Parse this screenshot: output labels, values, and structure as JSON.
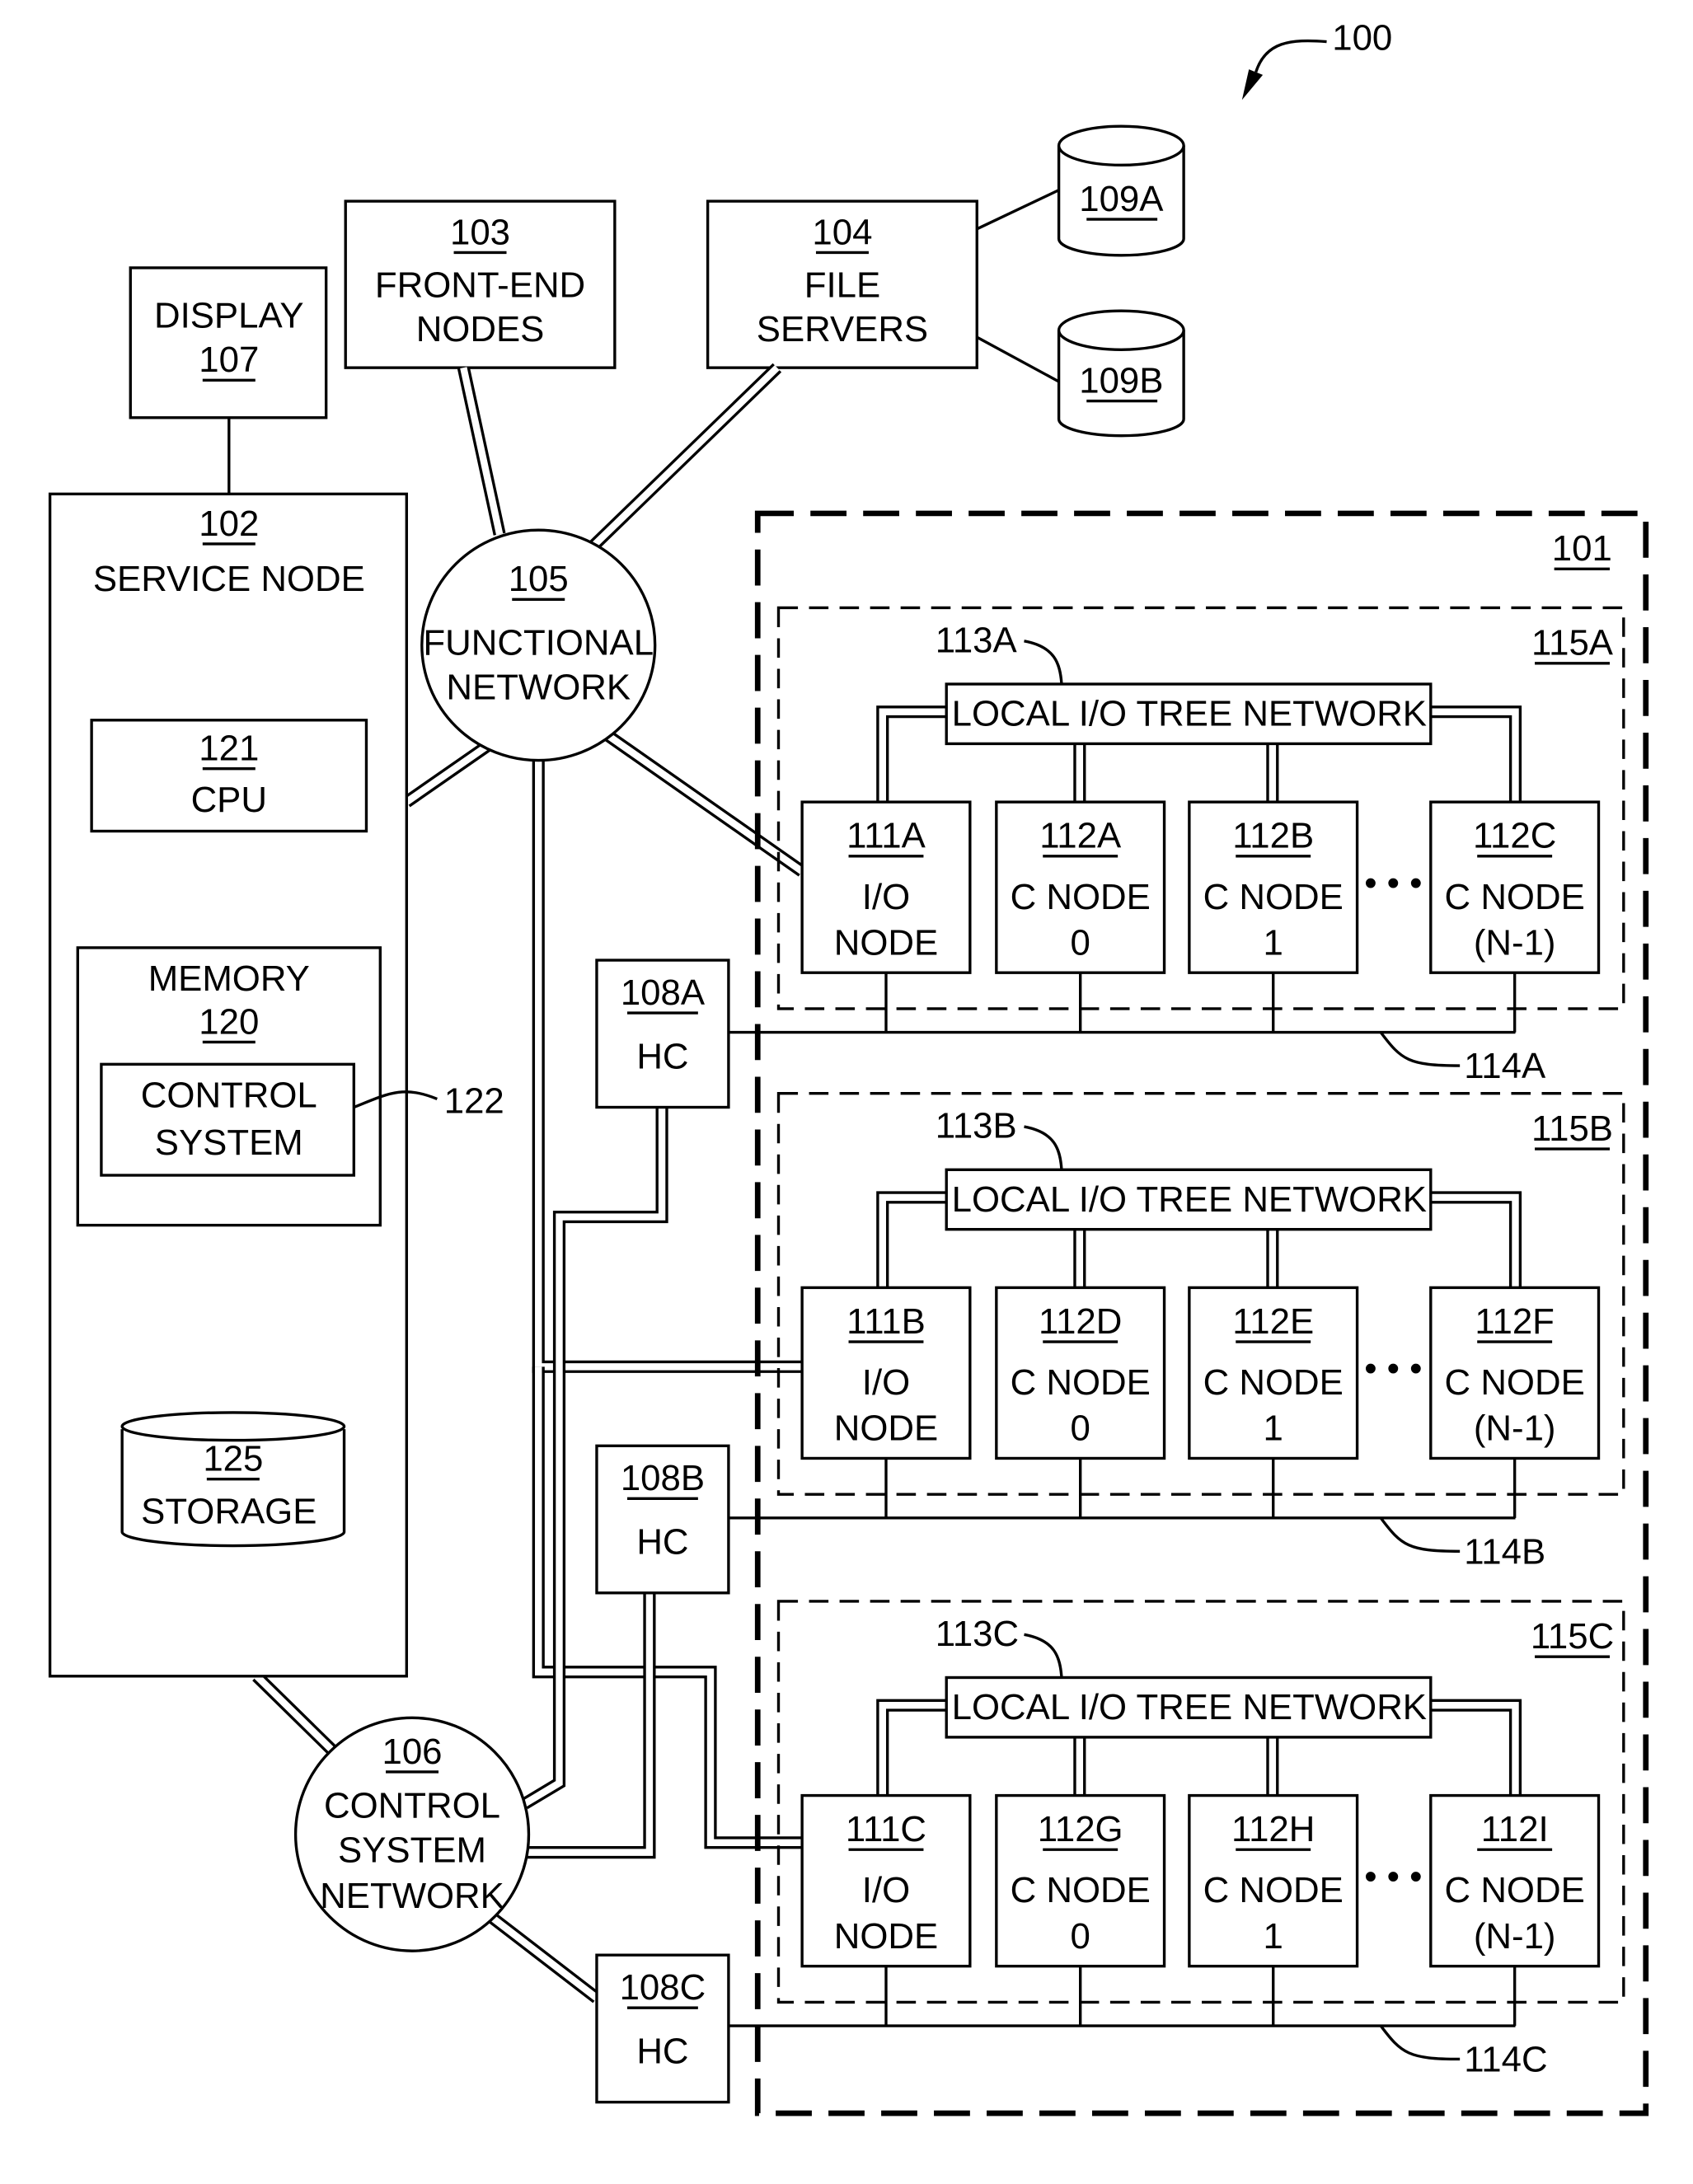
{
  "figure": {
    "ref": "100",
    "system_ref": "101"
  },
  "display": {
    "line1": "DISPLAY",
    "ref": "107"
  },
  "front_end": {
    "ref": "103",
    "line1": "FRONT-END",
    "line2": "NODES"
  },
  "file_servers": {
    "ref": "104",
    "line1": "FILE",
    "line2": "SERVERS"
  },
  "storage_a": {
    "ref": "109A"
  },
  "storage_b": {
    "ref": "109B"
  },
  "service_node": {
    "ref": "102",
    "label": "SERVICE NODE",
    "cpu": {
      "ref": "121",
      "label": "CPU"
    },
    "memory": {
      "label": "MEMORY",
      "ref": "120"
    },
    "control_system": {
      "line1": "CONTROL",
      "line2": "SYSTEM",
      "ref": "122"
    },
    "storage": {
      "ref": "125",
      "label": "STORAGE"
    }
  },
  "functional_network": {
    "ref": "105",
    "line1": "FUNCTIONAL",
    "line2": "NETWORK"
  },
  "control_network": {
    "ref": "106",
    "line1": "CONTROL",
    "line2": "SYSTEM",
    "line3": "NETWORK"
  },
  "hardware_controllers": [
    {
      "ref": "108A",
      "label": "HC"
    },
    {
      "ref": "108B",
      "label": "HC"
    },
    {
      "ref": "108C",
      "label": "HC"
    }
  ],
  "blocks": [
    {
      "ref": "115A",
      "tree_ref": "113A",
      "bus_ref": "114A",
      "tree_label": "LOCAL I/O TREE NETWORK",
      "nodes": [
        {
          "ref": "111A",
          "line1": "I/O",
          "line2": "NODE"
        },
        {
          "ref": "112A",
          "line1": "C NODE",
          "line2": "0"
        },
        {
          "ref": "112B",
          "line1": "C NODE",
          "line2": "1"
        },
        {
          "ref": "112C",
          "line1": "C NODE",
          "line2": "(N-1)"
        }
      ]
    },
    {
      "ref": "115B",
      "tree_ref": "113B",
      "bus_ref": "114B",
      "tree_label": "LOCAL I/O TREE NETWORK",
      "nodes": [
        {
          "ref": "111B",
          "line1": "I/O",
          "line2": "NODE"
        },
        {
          "ref": "112D",
          "line1": "C NODE",
          "line2": "0"
        },
        {
          "ref": "112E",
          "line1": "C NODE",
          "line2": "1"
        },
        {
          "ref": "112F",
          "line1": "C NODE",
          "line2": "(N-1)"
        }
      ]
    },
    {
      "ref": "115C",
      "tree_ref": "113C",
      "bus_ref": "114C",
      "tree_label": "LOCAL I/O TREE NETWORK",
      "nodes": [
        {
          "ref": "111C",
          "line1": "I/O",
          "line2": "NODE"
        },
        {
          "ref": "112G",
          "line1": "C NODE",
          "line2": "0"
        },
        {
          "ref": "112H",
          "line1": "C NODE",
          "line2": "1"
        },
        {
          "ref": "112I",
          "line1": "C NODE",
          "line2": "(N-1)"
        }
      ]
    }
  ],
  "ellipsis": "• • •"
}
